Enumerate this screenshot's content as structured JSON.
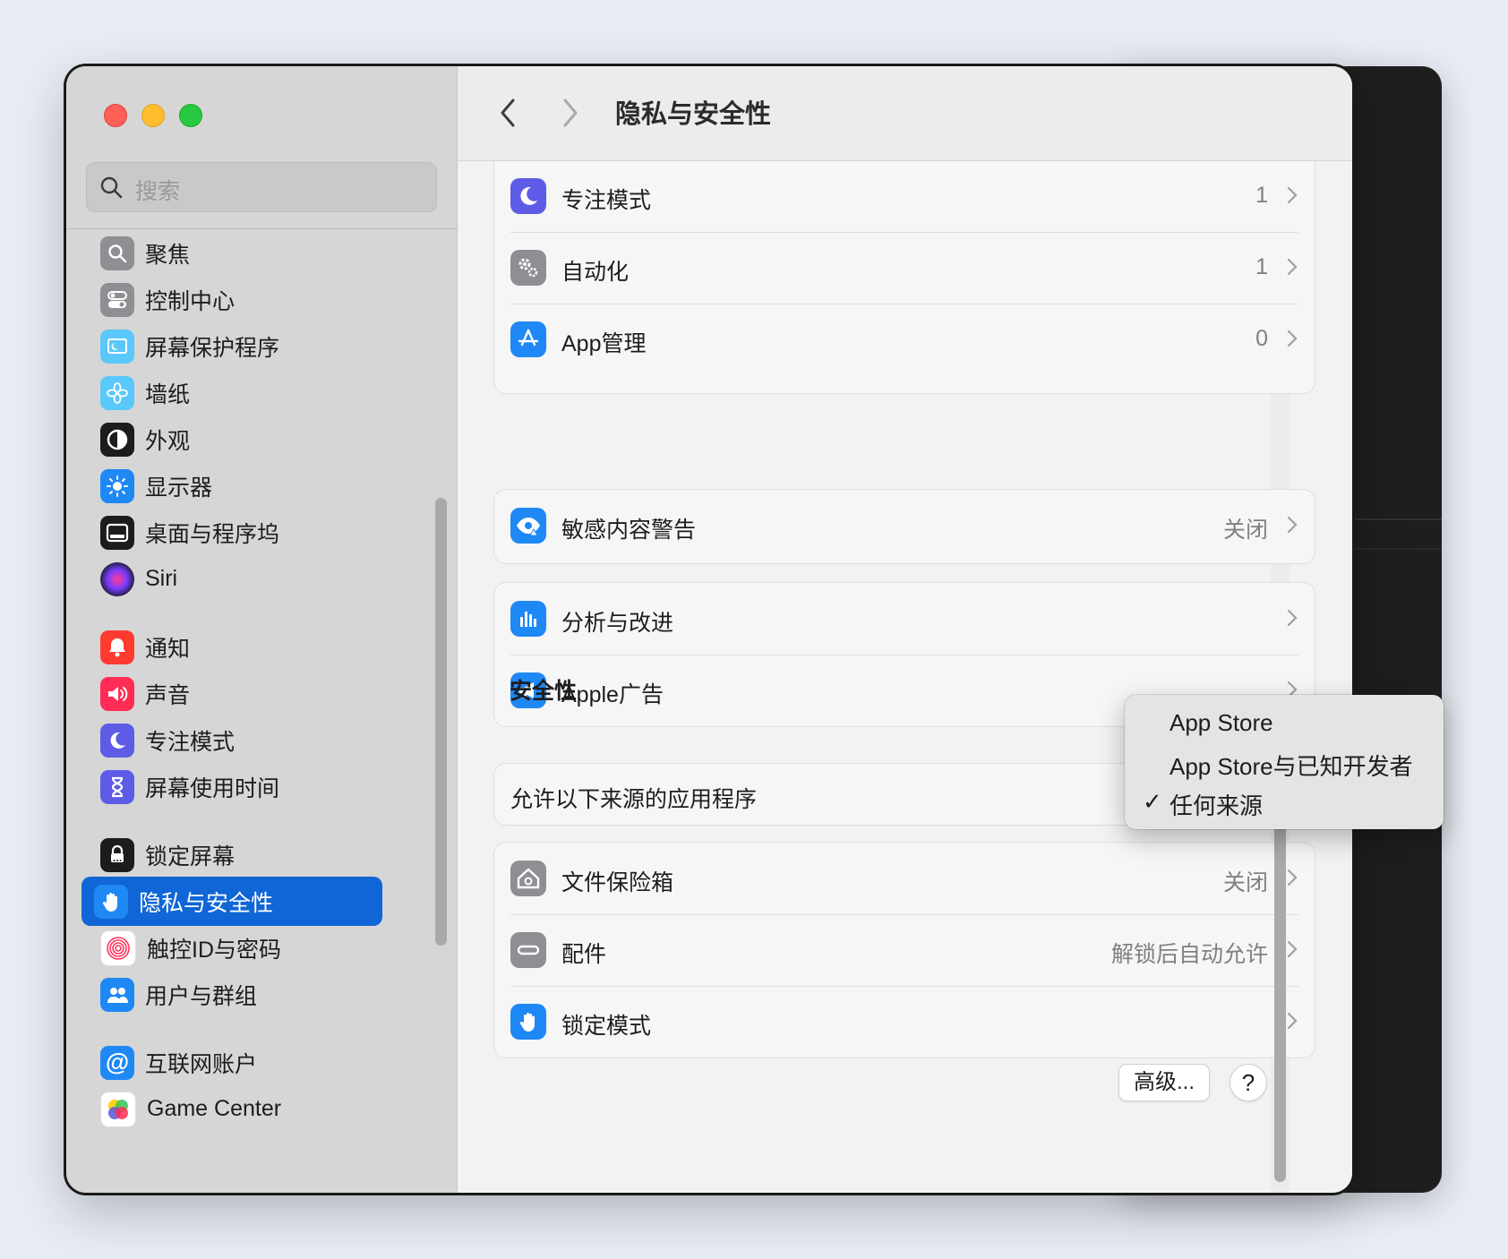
{
  "window": {
    "title": "隐私与安全性"
  },
  "search": {
    "placeholder": "搜索"
  },
  "sidebar": {
    "items": [
      {
        "label": "聚焦"
      },
      {
        "label": "控制中心"
      },
      {
        "label": "屏幕保护程序"
      },
      {
        "label": "墙纸"
      },
      {
        "label": "外观"
      },
      {
        "label": "显示器"
      },
      {
        "label": "桌面与程序坞"
      },
      {
        "label": "Siri"
      },
      {
        "label": "通知"
      },
      {
        "label": "声音"
      },
      {
        "label": "专注模式"
      },
      {
        "label": "屏幕使用时间"
      },
      {
        "label": "锁定屏幕"
      },
      {
        "label": "隐私与安全性",
        "selected": true
      },
      {
        "label": "触控ID与密码"
      },
      {
        "label": "用户与群组"
      },
      {
        "label": "互联网账户"
      },
      {
        "label": "Game Center"
      }
    ]
  },
  "privacy_rows": [
    {
      "label": "专注模式",
      "value": "1"
    },
    {
      "label": "自动化",
      "value": "1"
    },
    {
      "label": "App管理",
      "value": "0"
    }
  ],
  "sensitive": {
    "label": "敏感内容警告",
    "value": "关闭"
  },
  "analytics_rows": [
    {
      "label": "分析与改进"
    },
    {
      "label": "Apple广告"
    }
  ],
  "security": {
    "title": "安全性",
    "allow_label": "允许以下来源的应用程序"
  },
  "security_rows": [
    {
      "label": "文件保险箱",
      "value": "关闭"
    },
    {
      "label": "配件",
      "value": "解锁后自动允许"
    },
    {
      "label": "锁定模式",
      "value": ""
    }
  ],
  "buttons": {
    "advanced": "高级...",
    "help": "?"
  },
  "popup": {
    "options": [
      "App Store",
      "App Store与已知开发者",
      "任何来源"
    ],
    "selected": "任何来源",
    "check": "✓"
  }
}
